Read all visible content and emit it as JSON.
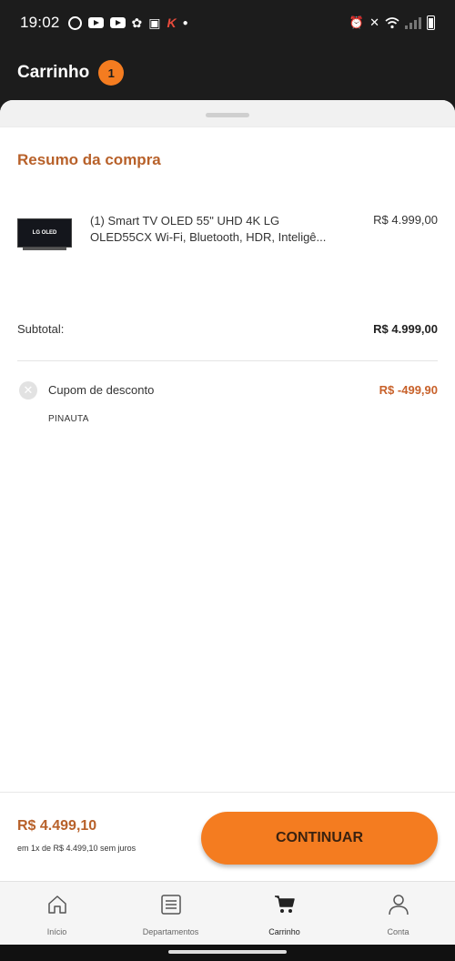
{
  "status_bar": {
    "time": "19:02"
  },
  "header": {
    "title": "Carrinho",
    "cart_count": "1"
  },
  "summary": {
    "title": "Resumo da compra",
    "thumbnail_text": "LG OLED",
    "product": {
      "name": "(1) Smart TV OLED 55\" UHD 4K LG OLED55CX Wi-Fi, Bluetooth, HDR, Inteligê...",
      "price": "R$ 4.999,00"
    },
    "subtotal_label": "Subtotal:",
    "subtotal_value": "R$ 4.999,00",
    "coupon": {
      "label": "Cupom de desconto",
      "code": "PINAUTA",
      "value": "R$ -499,90"
    }
  },
  "footer": {
    "total": "R$ 4.499,10",
    "installments": "em 1x de R$ 4.499,10 sem juros",
    "continue_label": "CONTINUAR"
  },
  "bottom_nav": {
    "items": [
      {
        "label": "Início",
        "icon": "home-icon"
      },
      {
        "label": "Departamentos",
        "icon": "list-icon"
      },
      {
        "label": "Carrinho",
        "icon": "cart-icon",
        "active": true
      },
      {
        "label": "Conta",
        "icon": "user-icon"
      }
    ]
  },
  "colors": {
    "accent": "#f47c20",
    "title_brown": "#b8612a",
    "dark_bar": "#1c1c1c"
  }
}
